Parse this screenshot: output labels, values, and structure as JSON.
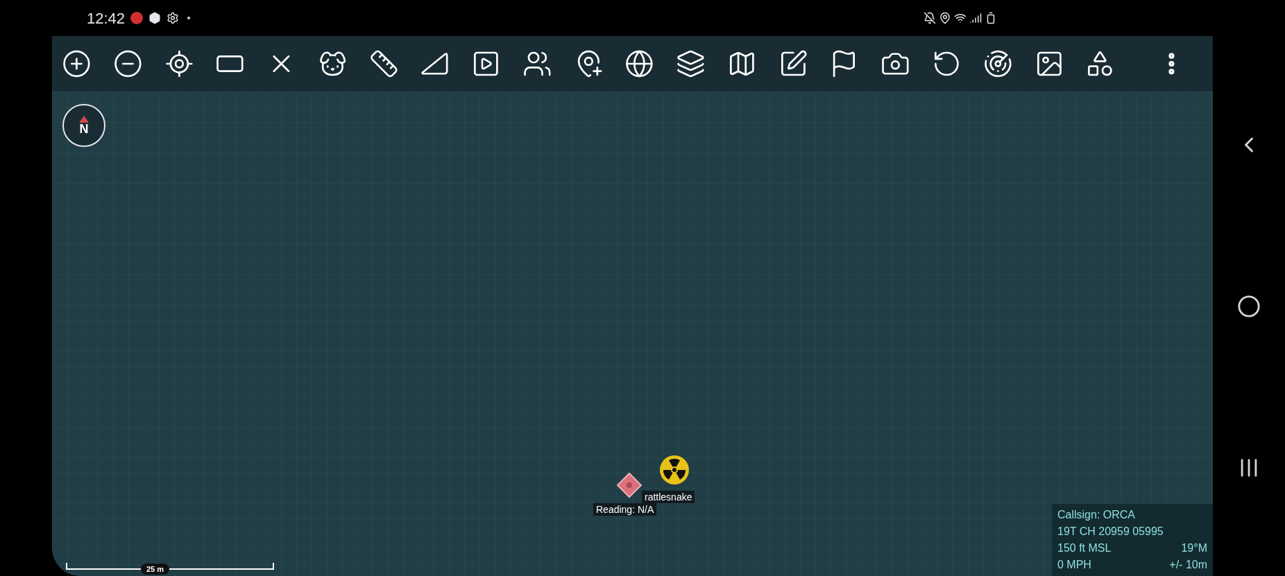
{
  "status_bar": {
    "time": "12:42"
  },
  "compass": {
    "label": "N"
  },
  "markers": [
    {
      "kind": "radiation",
      "label": "rattlesnake"
    },
    {
      "kind": "diamond",
      "label": "Reading: N/A"
    }
  ],
  "scale_bar": {
    "label": "25 m"
  },
  "info_panel": {
    "lines": [
      [
        "Callsign: ORCA"
      ],
      [
        "19T CH 20959 05995"
      ],
      [
        "150 ft MSL",
        "19°M"
      ],
      [
        "0 MPH",
        "+/- 10m"
      ]
    ]
  }
}
